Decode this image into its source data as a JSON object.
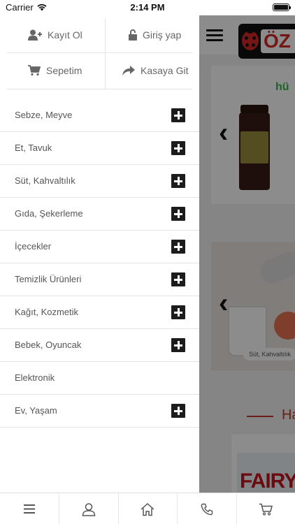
{
  "status_bar": {
    "carrier": "Carrier",
    "time": "2:14 PM",
    "wifi_icon": "wifi-icon",
    "battery_icon": "battery-icon"
  },
  "drawer": {
    "quick_actions": [
      {
        "label": "Kayıt Ol",
        "icon": "user-plus-icon"
      },
      {
        "label": "Giriş yap",
        "icon": "unlock-icon"
      },
      {
        "label": "Sepetim",
        "icon": "cart-icon"
      },
      {
        "label": "Kasaya Git",
        "icon": "share-arrow-icon"
      }
    ],
    "categories": [
      {
        "label": "Sebze, Meyve",
        "expandable": true
      },
      {
        "label": "Et, Tavuk",
        "expandable": true
      },
      {
        "label": "Süt, Kahvaltılık",
        "expandable": true
      },
      {
        "label": "Gıda, Şekerleme",
        "expandable": true
      },
      {
        "label": "İçecekler",
        "expandable": true
      },
      {
        "label": "Temizlik Ürünleri",
        "expandable": true
      },
      {
        "label": "Kağıt, Kozmetik",
        "expandable": true
      },
      {
        "label": "Bebek, Oyuncak",
        "expandable": true
      },
      {
        "label": "Elektronik",
        "expandable": false
      },
      {
        "label": "Ev, Yaşam",
        "expandable": true
      }
    ]
  },
  "background_app": {
    "logo_text": "ÖZ",
    "banner_brand_text": "hü",
    "banner2_tag": "Süt, Kahvaltılık",
    "section_title": "Ha",
    "product_brand": "FAIRY"
  },
  "tab_bar": {
    "tabs": [
      {
        "icon": "menu-icon"
      },
      {
        "icon": "user-icon"
      },
      {
        "icon": "home-icon"
      },
      {
        "icon": "phone-icon"
      },
      {
        "icon": "cart-icon"
      }
    ]
  },
  "colors": {
    "accent_red": "#c0392b",
    "plus_box": "#1c1c1c",
    "divider": "#e3e3e3"
  }
}
